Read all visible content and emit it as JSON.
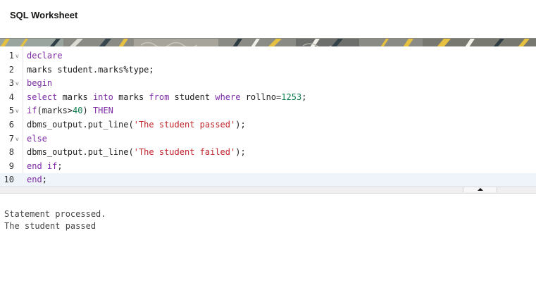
{
  "header": {
    "title": "SQL Worksheet"
  },
  "editor": {
    "lines": [
      {
        "num": "1",
        "foldable": true,
        "tokens": [
          {
            "t": "kw",
            "v": "declare"
          }
        ]
      },
      {
        "num": "2",
        "foldable": false,
        "tokens": [
          {
            "t": "plain",
            "v": "marks student.marks%type;"
          }
        ]
      },
      {
        "num": "3",
        "foldable": true,
        "tokens": [
          {
            "t": "kw",
            "v": "begin"
          }
        ]
      },
      {
        "num": "4",
        "foldable": false,
        "tokens": [
          {
            "t": "kw",
            "v": "select"
          },
          {
            "t": "plain",
            "v": " marks "
          },
          {
            "t": "kw",
            "v": "into"
          },
          {
            "t": "plain",
            "v": " marks "
          },
          {
            "t": "kw",
            "v": "from"
          },
          {
            "t": "plain",
            "v": " student "
          },
          {
            "t": "kw",
            "v": "where"
          },
          {
            "t": "plain",
            "v": " rollno="
          },
          {
            "t": "num",
            "v": "1253"
          },
          {
            "t": "plain",
            "v": ";"
          }
        ]
      },
      {
        "num": "5",
        "foldable": true,
        "tokens": [
          {
            "t": "kw",
            "v": "if"
          },
          {
            "t": "plain",
            "v": "(marks>"
          },
          {
            "t": "num",
            "v": "40"
          },
          {
            "t": "plain",
            "v": ") "
          },
          {
            "t": "kw",
            "v": "THEN"
          }
        ]
      },
      {
        "num": "6",
        "foldable": false,
        "tokens": [
          {
            "t": "plain",
            "v": "dbms_output.put_line("
          },
          {
            "t": "str",
            "v": "'The student passed'"
          },
          {
            "t": "plain",
            "v": ");"
          }
        ]
      },
      {
        "num": "7",
        "foldable": true,
        "tokens": [
          {
            "t": "kw",
            "v": "else"
          }
        ]
      },
      {
        "num": "8",
        "foldable": false,
        "tokens": [
          {
            "t": "plain",
            "v": "dbms_output.put_line("
          },
          {
            "t": "str",
            "v": "'The student failed'"
          },
          {
            "t": "plain",
            "v": ");"
          }
        ]
      },
      {
        "num": "9",
        "foldable": false,
        "tokens": [
          {
            "t": "kw",
            "v": "end if"
          },
          {
            "t": "plain",
            "v": ";"
          }
        ]
      },
      {
        "num": "10",
        "foldable": false,
        "active": true,
        "tokens": [
          {
            "t": "kw",
            "v": "end"
          },
          {
            "t": "plain",
            "v": ";"
          }
        ]
      }
    ],
    "fold_glyph": "v"
  },
  "output": {
    "status": "Statement processed.",
    "result": "The student passed"
  },
  "colors": {
    "keyword": "#7d2aa5",
    "string": "#c0262d",
    "number": "#0c7a4a",
    "active_line": "#eef4fa"
  },
  "icons": {
    "splitter": "triangle-up-icon"
  }
}
